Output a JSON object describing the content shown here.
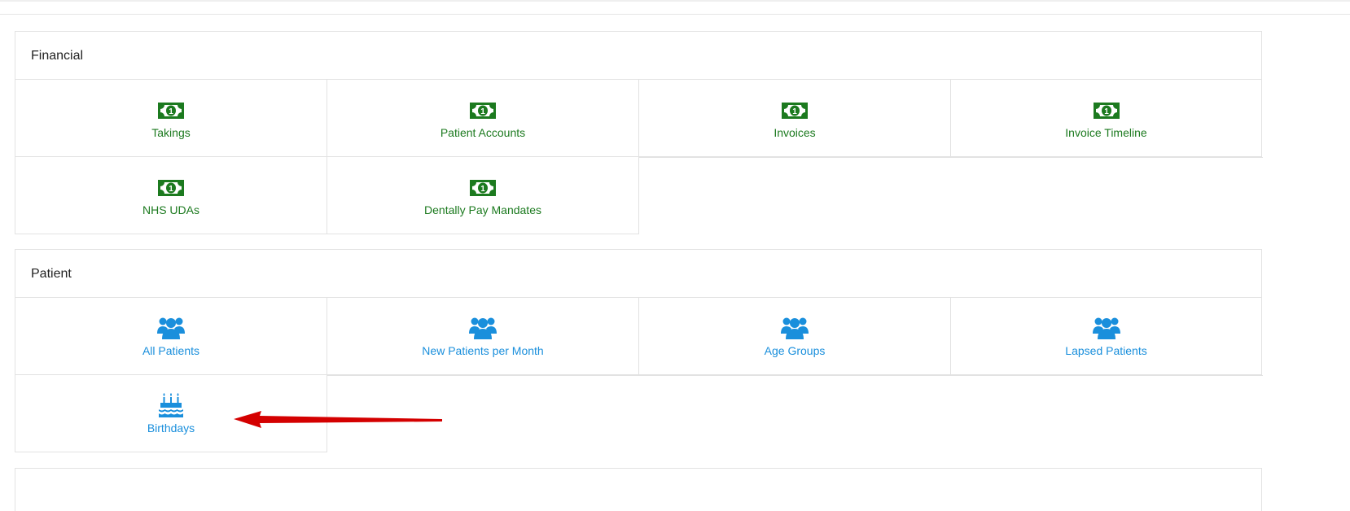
{
  "colors": {
    "financial_accent": "#1c7a1f",
    "patient_accent": "#1a8fdc",
    "annotation_arrow": "#d40000"
  },
  "sections": {
    "financial": {
      "title": "Financial",
      "items": [
        {
          "label": "Takings",
          "icon": "money-bill-icon"
        },
        {
          "label": "Patient Accounts",
          "icon": "money-bill-icon"
        },
        {
          "label": "Invoices",
          "icon": "money-bill-icon"
        },
        {
          "label": "Invoice Timeline",
          "icon": "money-bill-icon"
        },
        {
          "label": "NHS UDAs",
          "icon": "money-bill-icon"
        },
        {
          "label": "Dentally Pay Mandates",
          "icon": "money-bill-icon"
        }
      ]
    },
    "patient": {
      "title": "Patient",
      "items": [
        {
          "label": "All Patients",
          "icon": "users-icon"
        },
        {
          "label": "New Patients per Month",
          "icon": "users-icon"
        },
        {
          "label": "Age Groups",
          "icon": "users-icon"
        },
        {
          "label": "Lapsed Patients",
          "icon": "users-icon"
        },
        {
          "label": "Birthdays",
          "icon": "birthday-cake-icon"
        }
      ]
    }
  }
}
